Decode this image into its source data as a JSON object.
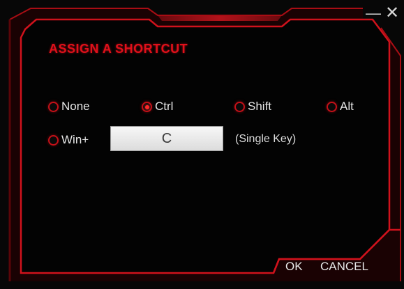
{
  "window": {
    "minimize_label": "—",
    "close_label": "✕"
  },
  "dialog": {
    "title": "ASSIGN A SHORTCUT",
    "modifiers": [
      {
        "label": "None",
        "checked": false
      },
      {
        "label": "Ctrl",
        "checked": true
      },
      {
        "label": "Shift",
        "checked": false
      },
      {
        "label": "Alt",
        "checked": false
      },
      {
        "label": "Win+",
        "checked": false
      }
    ],
    "key_value": "C",
    "key_note": "(Single Key)",
    "ok_label": "OK",
    "cancel_label": "CANCEL"
  },
  "colors": {
    "accent": "#e0101a",
    "background": "#070707",
    "text": "#e6e6e6"
  }
}
